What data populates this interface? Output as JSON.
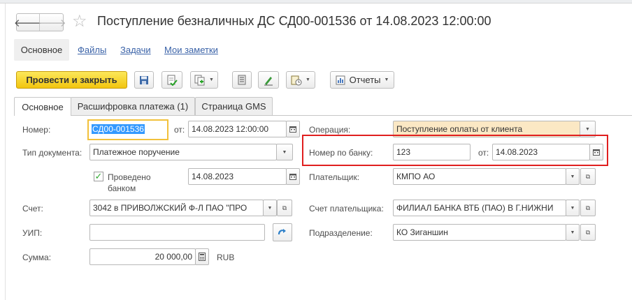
{
  "title": "Поступление безналичных ДС СД00-001536 от 14.08.2023 12:00:00",
  "sections": [
    {
      "label": "Основное"
    },
    {
      "label": "Файлы"
    },
    {
      "label": "Задачи"
    },
    {
      "label": "Мои заметки"
    }
  ],
  "toolbar": {
    "post_close_label": "Провести и закрыть",
    "reports_label": "Отчеты"
  },
  "tabs": [
    {
      "label": "Основное"
    },
    {
      "label": "Расшифровка платежа (1)"
    },
    {
      "label": "Страница GMS"
    }
  ],
  "form": {
    "number": {
      "label": "Номер:",
      "value": "СД00-001536"
    },
    "date": {
      "label": "от:",
      "value": "14.08.2023 12:00:00"
    },
    "doc_type": {
      "label": "Тип документа:",
      "value": "Платежное поручение"
    },
    "bank_posted": {
      "label": "Проведено банком",
      "checked": true,
      "date": "14.08.2023"
    },
    "account": {
      "label": "Счет:",
      "value": "3042 в ПРИВОЛЖСКИЙ Ф-Л ПАО \"ПРО"
    },
    "uip": {
      "label": "УИП:",
      "value": ""
    },
    "amount": {
      "label": "Сумма:",
      "value": "20 000,00",
      "currency": "RUB"
    },
    "operation": {
      "label": "Операция:",
      "value": "Поступление оплаты от клиента"
    },
    "bank_number": {
      "label": "Номер по банку:",
      "value": "123"
    },
    "bank_date": {
      "label": "от:",
      "value": "14.08.2023"
    },
    "payer": {
      "label": "Плательщик:",
      "value": "КМПО АО"
    },
    "payer_account": {
      "label": "Счет плательщика:",
      "value": "ФИЛИАЛ БАНКА ВТБ (ПАО) В Г.НИЖНИ"
    },
    "department": {
      "label": "Подразделение:",
      "value": "КО Зиганшин"
    }
  },
  "colors": {
    "primary_button": "#f5cf22",
    "link": "#3b63a8",
    "highlight_box": "#e01f1f",
    "selection": "#3399ff"
  },
  "icons": [
    "back-arrow-icon",
    "forward-arrow-icon",
    "star-icon",
    "save-icon",
    "post-icon",
    "create-based-icon",
    "list-icon",
    "edit-icon",
    "attach-icon",
    "report-icon",
    "calendar-icon",
    "open-icon",
    "chevron-down-icon",
    "refresh-arrow-icon",
    "calculator-icon",
    "checkmark-icon"
  ]
}
